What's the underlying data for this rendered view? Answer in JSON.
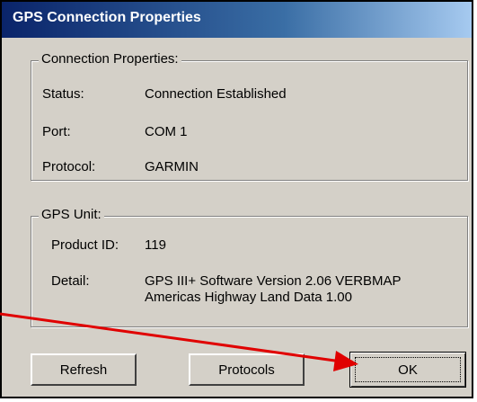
{
  "window": {
    "title": "GPS Connection Properties"
  },
  "connection": {
    "legend": "Connection Properties:",
    "status_label": "Status:",
    "status_value": "Connection Established",
    "port_label": "Port:",
    "port_value": "COM 1",
    "protocol_label": "Protocol:",
    "protocol_value": "GARMIN"
  },
  "gps_unit": {
    "legend": "GPS Unit:",
    "product_id_label": "Product ID:",
    "product_id_value": "119",
    "detail_label": "Detail:",
    "detail_line1": "GPS III+ Software Version  2.06  VERBMAP",
    "detail_line2": "Americas Highway Land Data 1.00"
  },
  "buttons": {
    "refresh": "Refresh",
    "protocols": "Protocols",
    "ok": "OK"
  },
  "annotation": {
    "arrow_color": "#e00000"
  }
}
